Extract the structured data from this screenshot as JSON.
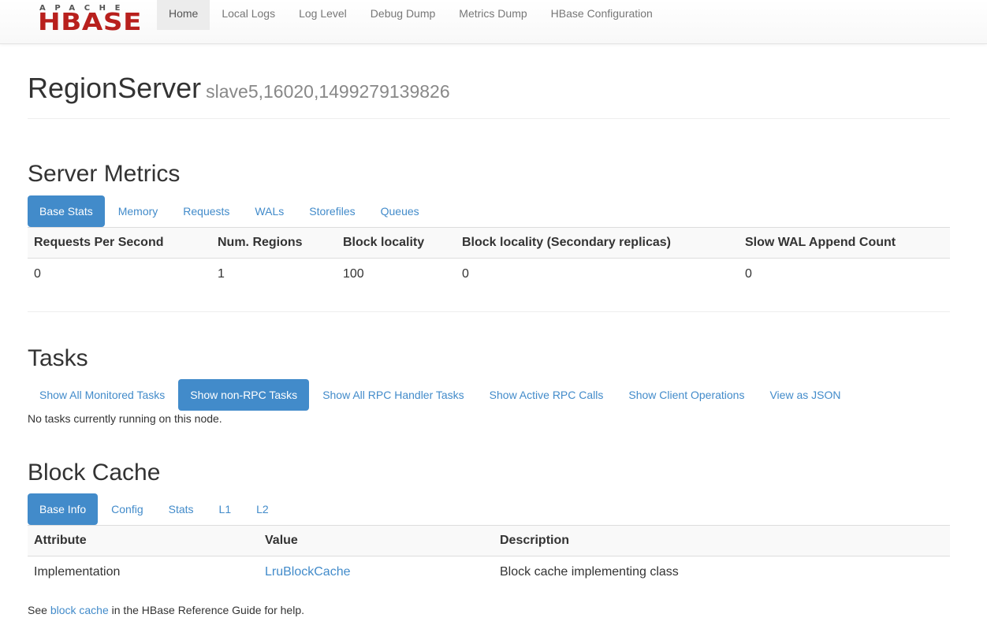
{
  "logo": {
    "top": "APACHE",
    "main": "HBASE"
  },
  "nav": [
    "Home",
    "Local Logs",
    "Log Level",
    "Debug Dump",
    "Metrics Dump",
    "HBase Configuration"
  ],
  "header": {
    "title": "RegionServer",
    "subtitle": "slave5,16020,1499279139826"
  },
  "server_metrics": {
    "title": "Server Metrics",
    "tabs": [
      "Base Stats",
      "Memory",
      "Requests",
      "WALs",
      "Storefiles",
      "Queues"
    ],
    "columns": [
      "Requests Per Second",
      "Num. Regions",
      "Block locality",
      "Block locality (Secondary replicas)",
      "Slow WAL Append Count"
    ],
    "row": [
      "0",
      "1",
      "100",
      "0",
      "0"
    ]
  },
  "tasks": {
    "title": "Tasks",
    "tabs": [
      "Show All Monitored Tasks",
      "Show non-RPC Tasks",
      "Show All RPC Handler Tasks",
      "Show Active RPC Calls",
      "Show Client Operations",
      "View as JSON"
    ],
    "message": "No tasks currently running on this node."
  },
  "block_cache": {
    "title": "Block Cache",
    "tabs": [
      "Base Info",
      "Config",
      "Stats",
      "L1",
      "L2"
    ],
    "columns": [
      "Attribute",
      "Value",
      "Description"
    ],
    "row": [
      "Implementation",
      "LruBlockCache",
      "Block cache implementing class"
    ],
    "note_prefix": "See ",
    "note_link": "block cache",
    "note_suffix": " in the HBase Reference Guide for help."
  },
  "colors": {
    "accent": "#428bca",
    "brand": "#b8201d"
  }
}
